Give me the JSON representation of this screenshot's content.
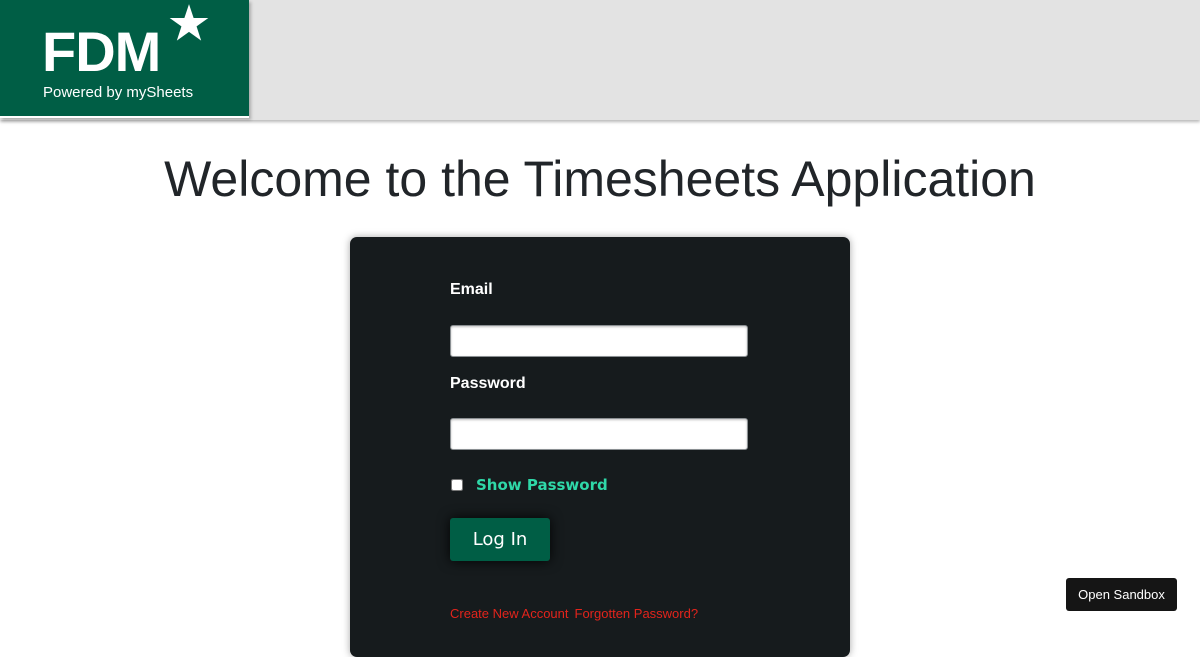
{
  "header": {
    "logo_text": "FDM",
    "logo_subtitle": "Powered by mySheets",
    "logo_icon": "star-icon",
    "brand_color": "#005e45"
  },
  "main": {
    "title": "Welcome to the Timesheets Application"
  },
  "login_form": {
    "email_label": "Email",
    "email_value": "",
    "password_label": "Password",
    "password_value": "",
    "show_password_label": "Show Password",
    "show_password_checked": false,
    "login_button_label": "Log In",
    "create_account_link": "Create New Account",
    "forgot_password_link": "Forgotten Password?",
    "card_color": "#161b1d",
    "accent_color": "#2fd8a8",
    "link_color": "#e2241c"
  },
  "sandbox": {
    "button_label": "Open Sandbox"
  }
}
